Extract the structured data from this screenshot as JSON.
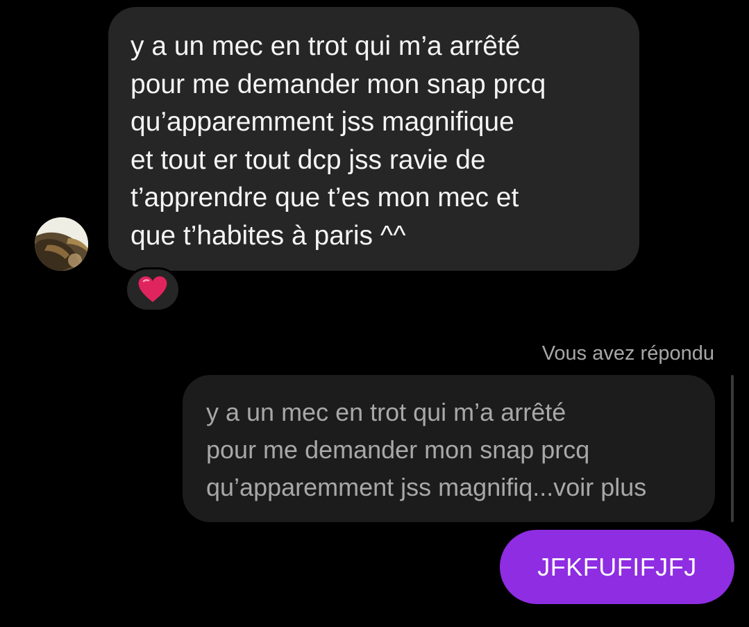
{
  "conversation": {
    "incoming_message": {
      "text": "y a un mec en trot qui m’a arrêté\npour me demander mon snap prcq\nqu’apparemment jss magnifique\net tout er tout dcp jss ravie de\nt’apprendre que t’es mon mec et\nque t’habites à paris ^^",
      "reaction_icon": "red-heart-icon"
    },
    "reply": {
      "label": "Vous avez répondu",
      "quoted_text": "y a un mec en trot qui m’a arrêté\npour me demander mon snap prcq\nqu’apparemment jss magnifiq...voir plus",
      "outgoing_text": "JFKFUFIFJFJ"
    }
  },
  "colors": {
    "background": "#000000",
    "incoming_bubble": "#262626",
    "quoted_bubble": "#1c1c1c",
    "outgoing_bubble": "#8e2de2",
    "muted_text": "#a8a8a8",
    "primary_text": "#f5f5f5",
    "reaction_heart": "#e0245e"
  }
}
